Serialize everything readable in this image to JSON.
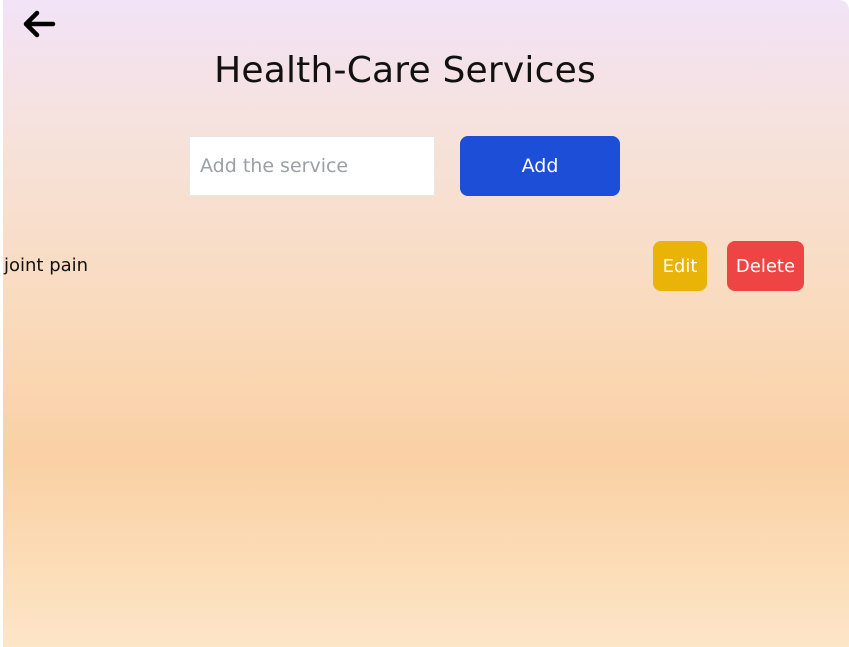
{
  "header": {
    "back_icon": "arrow-left-icon",
    "title": "Health-Care Services"
  },
  "add_form": {
    "input_value": "",
    "input_placeholder": "Add the service",
    "add_label": "Add"
  },
  "services": [
    {
      "name": "joint pain",
      "edit_label": "Edit",
      "delete_label": "Delete"
    }
  ],
  "colors": {
    "add_button": "#1d4ed8",
    "edit_button": "#eab308",
    "delete_button": "#ef4444",
    "background_top": "#f2e3f7",
    "background_bottom": "#fde5c8"
  }
}
